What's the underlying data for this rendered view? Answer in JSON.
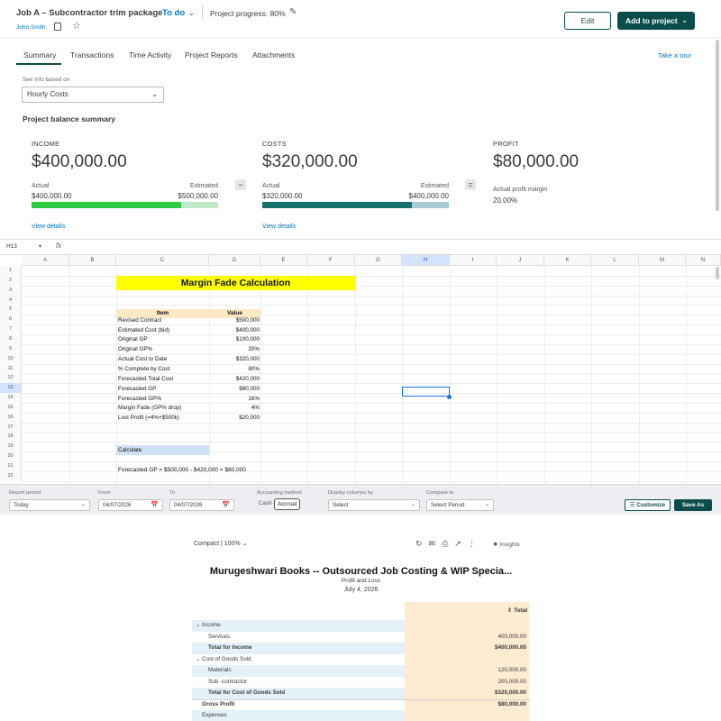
{
  "header": {
    "job_title": "Job A – Subcontractor trim package",
    "status": "To do",
    "progress_text": "Project progress: 80%",
    "owner": "John Smith",
    "edit_label": "Edit",
    "add_label": "Add to project"
  },
  "tabs": [
    "Summary",
    "Transactions",
    "Time Activity",
    "Project Reports",
    "Attachments"
  ],
  "tour_label": "Take a tour",
  "see_info_label": "See info based on",
  "see_info_value": "Hourly Costs",
  "balance_title": "Project balance summary",
  "cards": {
    "income": {
      "label": "INCOME",
      "amount": "$400,000.00",
      "actual_label": "Actual",
      "estimated_label": "Estimated",
      "actual_value": "$400,000.00",
      "estimated_value": "$500,000.00",
      "progress": 0.8,
      "fg_color": "#2ecc40",
      "bg_color": "#c4ebc9",
      "link": "View details"
    },
    "costs": {
      "label": "COSTS",
      "amount": "$320,000.00",
      "actual_label": "Actual",
      "estimated_label": "Estimated",
      "actual_value": "$320,000.00",
      "estimated_value": "$400,000.00",
      "progress": 0.8,
      "fg_color": "#17706c",
      "bg_color": "#a9cdd2",
      "link": "View details"
    },
    "profit": {
      "label": "PROFIT",
      "amount": "$80,000.00",
      "margin_label": "Actual profit margin",
      "margin_value": "20.00%"
    },
    "minus": "−",
    "equals": "="
  },
  "sheet": {
    "cell_ref": "H13",
    "fx": "fx",
    "columns": [
      "A",
      "B",
      "C",
      "D",
      "E",
      "F",
      "G",
      "H",
      "I",
      "J",
      "K",
      "L",
      "M",
      "N"
    ],
    "rows": [
      "1",
      "2",
      "3",
      "4",
      "5",
      "6",
      "7",
      "8",
      "9",
      "10",
      "11",
      "12",
      "13",
      "14",
      "15",
      "16",
      "17",
      "18",
      "19",
      "20",
      "21",
      "22"
    ],
    "title": "Margin Fade Calculation",
    "header_item": "Item",
    "header_value": "Value",
    "items": [
      {
        "item": "Revised Contract",
        "value": "$500,000"
      },
      {
        "item": "Estimated Cost (bid)",
        "value": "$400,000"
      },
      {
        "item": "Original GP",
        "value": "$100,000"
      },
      {
        "item": "Original GP%",
        "value": "20%"
      },
      {
        "item": "Actual Cost to Date",
        "value": "$320,000"
      },
      {
        "item": "% Complete by Cost",
        "value": "80%"
      },
      {
        "item": "Forecasted Total Cost",
        "value": "$420,000"
      },
      {
        "item": "Forecasted GP",
        "value": "$80,000"
      },
      {
        "item": "Forecasted GP%",
        "value": "16%"
      },
      {
        "item": "Margin Fade (GP% drop)",
        "value": "4%"
      },
      {
        "item": "Lost Profit (=4%×$500k)",
        "value": "$20,000"
      }
    ],
    "calculate": "Calculate",
    "note": "Forecasted GP = $500,000 - $420,000 = $80,000"
  },
  "report_toolbar": {
    "period_label": "Report period",
    "period_value": "Today",
    "from_label": "From",
    "from_value": "04/07/2026",
    "to_label": "To",
    "to_value": "04/07/2026",
    "method_label": "Accounting method",
    "cash": "Cash",
    "accrual": "Accrual",
    "display_label": "Display columns by",
    "display_value": "Select",
    "compare_label": "Compare to",
    "compare_value": "Select Period",
    "customize": "Customize",
    "save_as": "Save As"
  },
  "report": {
    "compact": "Compact | 100%",
    "insights": "Insights",
    "title": "Murugeshwari Books -- Outsourced Job Costing & WIP Specia...",
    "subtitle": "Profit and Loss",
    "date": "July 4, 2026",
    "total_header": "Total",
    "rows": [
      {
        "label": "Income",
        "amount": "",
        "indent": 0,
        "bold": false,
        "caret": true,
        "shade": true,
        "topline": false
      },
      {
        "label": "Services",
        "amount": "400,000.00",
        "indent": 2,
        "bold": false,
        "caret": false,
        "shade": false,
        "topline": false
      },
      {
        "label": "Total for Income",
        "amount": "$400,000.00",
        "indent": 2,
        "bold": true,
        "caret": false,
        "shade": true,
        "topline": false
      },
      {
        "label": "Cost of Goods Sold",
        "amount": "",
        "indent": 0,
        "bold": false,
        "caret": true,
        "shade": false,
        "topline": false
      },
      {
        "label": "Materials",
        "amount": "120,000.00",
        "indent": 2,
        "bold": false,
        "caret": false,
        "shade": true,
        "topline": false
      },
      {
        "label": "Sub -contractor",
        "amount": "200,000.00",
        "indent": 2,
        "bold": false,
        "caret": false,
        "shade": false,
        "topline": false
      },
      {
        "label": "Total for Cost of Goods Sold",
        "amount": "$320,000.00",
        "indent": 2,
        "bold": true,
        "caret": false,
        "shade": true,
        "topline": false
      },
      {
        "label": "Gross Profit",
        "amount": "$80,000.00",
        "indent": 1,
        "bold": true,
        "caret": false,
        "shade": false,
        "topline": true
      },
      {
        "label": "Expenses",
        "amount": "",
        "indent": 1,
        "bold": false,
        "caret": false,
        "shade": true,
        "topline": false
      }
    ]
  }
}
